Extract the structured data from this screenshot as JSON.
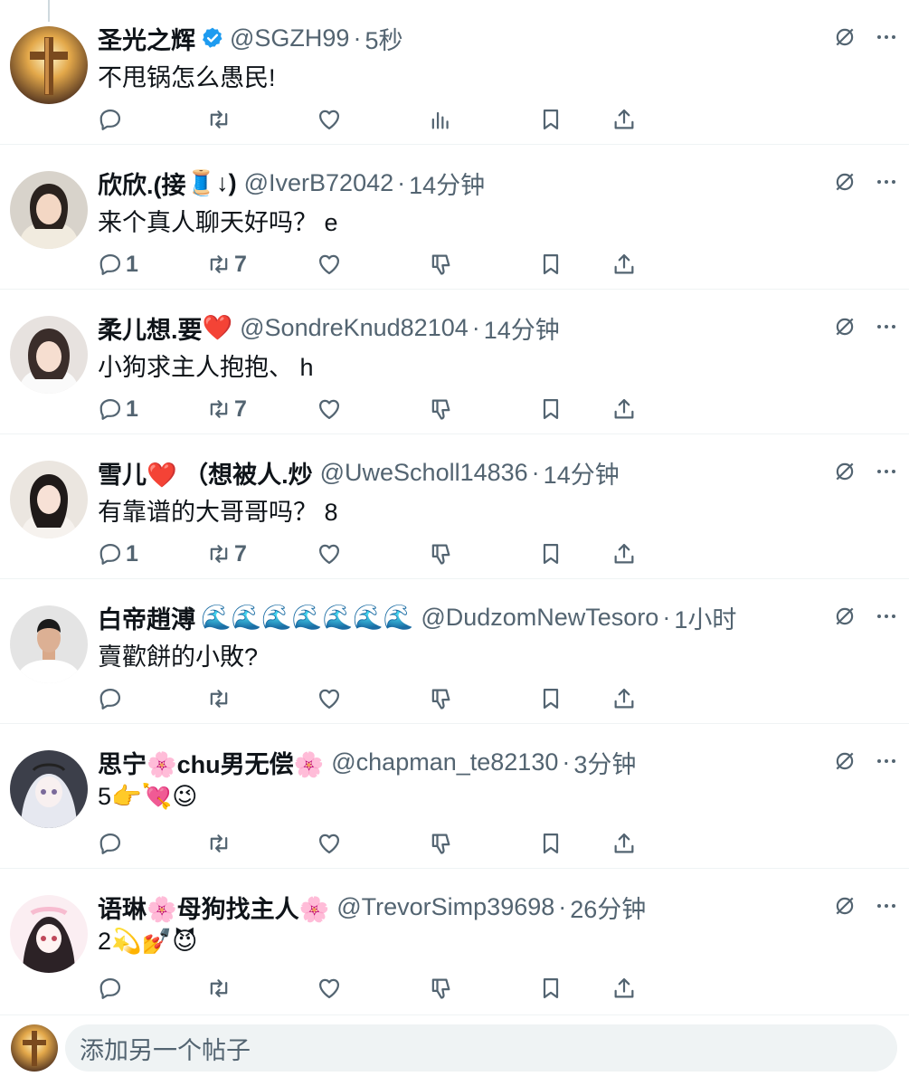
{
  "posts": [
    {
      "name": "圣光之辉",
      "verified": true,
      "name_suffix": "",
      "handle": "@SGZH99",
      "dot": "·",
      "time": "5秒",
      "content": "不甩锅怎么愚民!",
      "reply_count": "",
      "repost_count": "",
      "third_action": "views",
      "avatar": "cross-avatar"
    },
    {
      "name": "欣欣.(接",
      "verified": false,
      "name_suffix": "🧵↓)",
      "handle": "@IverB72042",
      "dot": "·",
      "time": "14分钟",
      "content": "来个真人聊天好吗？ e",
      "reply_count": "1",
      "repost_count": "7",
      "third_action": "dislike",
      "avatar": "girl-avatar"
    },
    {
      "name": "柔儿想.要",
      "verified": false,
      "name_suffix": "❤️",
      "handle": "@SondreKnud82104",
      "dot": "·",
      "time": "14分钟",
      "content": "小狗求主人抱抱、 h",
      "reply_count": "1",
      "repost_count": "7",
      "third_action": "dislike",
      "avatar": "girl-avatar"
    },
    {
      "name": "雪儿",
      "verified": false,
      "name_suffix": "❤️ （想被人.炒",
      "handle": "@UweScholl14836",
      "dot": "·",
      "time": "14分钟",
      "content": "有靠谱的大哥哥吗？ 8",
      "reply_count": "1",
      "repost_count": "7",
      "third_action": "dislike",
      "avatar": "girl-avatar"
    },
    {
      "name": "白帝趙溥",
      "verified": false,
      "name_suffix": "🌊🌊🌊🌊🌊🌊🌊",
      "handle": "@DudzomNewTesoro",
      "dot": "·",
      "time": "1小时",
      "content": "賣歡餅的小敗?",
      "reply_count": "",
      "repost_count": "",
      "third_action": "dislike",
      "avatar": "man-avatar"
    },
    {
      "name": "思宁🌸chu男无偿🌸",
      "verified": false,
      "name_suffix": "",
      "handle": "@chapman_te82130",
      "dot": "·",
      "time": "3分钟",
      "content": "5👉💘😉",
      "reply_count": "",
      "repost_count": "",
      "third_action": "dislike",
      "avatar": "anime-avatar"
    },
    {
      "name": "语琳🌸母狗找主人🌸",
      "verified": false,
      "name_suffix": "",
      "handle": "@TrevorSimp39698",
      "dot": "·",
      "time": "26分钟",
      "content": "2💫💅😈",
      "reply_count": "",
      "repost_count": "",
      "third_action": "dislike",
      "avatar": "anime-avatar"
    }
  ],
  "compose": {
    "placeholder": "添加另一个帖子"
  },
  "colors": {
    "text": "#0f1419",
    "secondary": "#536471",
    "verified": "#1d9bf0",
    "divider": "#eff3f4",
    "input_bg": "#eff3f4"
  }
}
